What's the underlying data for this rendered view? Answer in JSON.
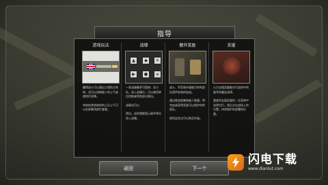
{
  "dialog": {
    "title": "指导"
  },
  "columns": [
    {
      "heading": "游戏玩法",
      "paragraphs": [
        "赢得战斗可以通过占领防方阵地，也可以消耗敌人的士气或使他们投降。",
        "夺取的阵地和你的士兵士气可以在屏幕顶部栏查看。"
      ]
    },
    {
      "heading": "战壕",
      "paragraphs": [
        "一条战壕最多可容纳：及小队。进入战壕后，可以使用单位控制来将其部分移出。",
        "战壕也可以",
        "除出，这样就能阻止敌军单位进入战壕。"
      ]
    },
    {
      "heading": "额外奖励",
      "paragraphs": [
        "战斗、军官和升级能力你的部队提供有效的加成。",
        "通过挑战收集和敌人联盟，将完成或获得奖励可以保护你的部队。",
        "使用这些点可以购买升级。"
      ]
    },
    {
      "heading": "支援",
      "paragraphs": [
        "火力支援武器能对付战场中的敌军的最佳选择。",
        "要使用支援武器时，在菜单中选择它们，然后点击战场上的位置。持续保护你部署的位置。"
      ]
    }
  ],
  "buttons": {
    "back": "返回",
    "next": "下一个"
  },
  "watermark": {
    "name": "闪电下载",
    "url": "www.dianlut.com"
  }
}
